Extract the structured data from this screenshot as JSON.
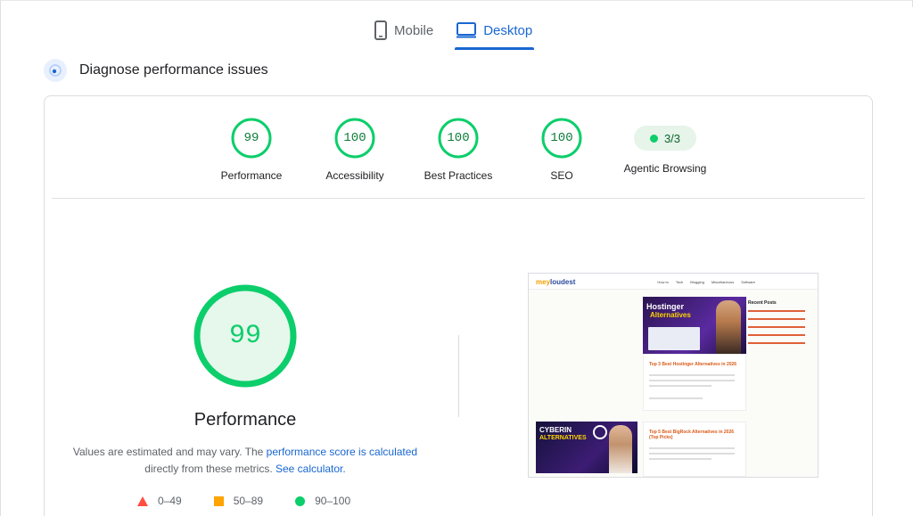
{
  "tabs": [
    {
      "label": "Mobile",
      "icon": "mobile-phone-icon",
      "active": false
    },
    {
      "label": "Desktop",
      "icon": "desktop-monitor-icon",
      "active": true
    }
  ],
  "section": {
    "title": "Diagnose performance issues",
    "icon": "diagnose-icon"
  },
  "scores": [
    {
      "label": "Performance",
      "value": "99",
      "score": 99
    },
    {
      "label": "Accessibility",
      "value": "100",
      "score": 100
    },
    {
      "label": "Best Practices",
      "value": "100",
      "score": 100
    },
    {
      "label": "SEO",
      "value": "100",
      "score": 100
    }
  ],
  "agentic": {
    "label": "Agentic Browsing",
    "value": "3/3"
  },
  "main_gauge": {
    "value": "99",
    "score": 99,
    "title": "Performance"
  },
  "note": {
    "text_before": "Values are estimated and may vary. The ",
    "link1": "performance score is calculated",
    "text_middle": "directly from these metrics.",
    "link2": "See calculator."
  },
  "legend": [
    {
      "range": "0–49",
      "shape": "triangle",
      "color": "#ff4e42"
    },
    {
      "range": "50–89",
      "shape": "square",
      "color": "#ffa400"
    },
    {
      "range": "90–100",
      "shape": "circle",
      "color": "#0cce6b"
    }
  ],
  "thumbnail": {
    "logo_prefix": "mey",
    "logo_suffix": "loudest",
    "menu": [
      "How to",
      "Tech",
      "Blogging",
      "Miscellaneous",
      "Software"
    ],
    "hero_line1": "Hostinger",
    "hero_line2": "Alternatives",
    "card1_title": "Top 3 Best Hostinger Alternatives in 2026",
    "sidebar_title": "Recent Posts",
    "hero2_line1": "CYBERIN",
    "hero2_line2": "ALTERNATIVES",
    "card2_title": "Top 5 Best BigRock Alternatives in 2026 (Top Picks)"
  },
  "colors": {
    "accent": "#1967d2",
    "pass": "#0cce6b",
    "pass_text": "#0d7c3a",
    "pass_bg": "#e6f4ea"
  }
}
